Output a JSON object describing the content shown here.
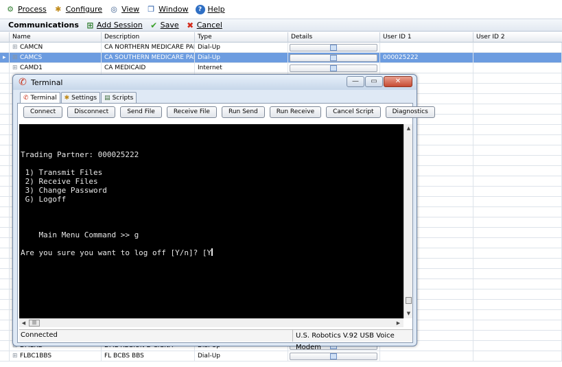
{
  "menubar": {
    "items": [
      {
        "label": "Process",
        "icon": "process-icon"
      },
      {
        "label": "Configure",
        "icon": "configure-icon"
      },
      {
        "label": "View",
        "icon": "view-icon"
      },
      {
        "label": "Window",
        "icon": "window-icon"
      },
      {
        "label": "Help",
        "icon": "help-icon"
      }
    ]
  },
  "toolbar": {
    "title": "Communications",
    "add_session_label": "Add Session",
    "save_label": "Save",
    "cancel_label": "Cancel"
  },
  "grid": {
    "columns": [
      "Name",
      "Description",
      "Type",
      "Details",
      "User ID 1",
      "User ID 2"
    ],
    "rows": [
      {
        "name": "CAMCN",
        "description": "CA NORTHERN MEDICARE PART B",
        "type": "Dial-Up",
        "user_id_1": "",
        "user_id_2": ""
      },
      {
        "name": "CAMCS",
        "description": "CA SOUTHERN MEDICARE PART B",
        "type": "Dial-Up",
        "user_id_1": "000025222",
        "user_id_2": "",
        "selected": true
      },
      {
        "name": "CAMD1",
        "description": "CA MEDICAID",
        "type": "Internet",
        "user_id_1": "",
        "user_id_2": ""
      }
    ],
    "bottom_rows": [
      {
        "name": "DMERD",
        "description": "DME REGION D CIGNA",
        "type": "Dial-Up"
      },
      {
        "name": "FLBC1BBS",
        "description": "FL BCBS BBS",
        "type": "Dial-Up"
      }
    ]
  },
  "terminal": {
    "title": "Terminal",
    "tabs": [
      "Terminal",
      "Settings",
      "Scripts"
    ],
    "buttons": [
      "Connect",
      "Disconnect",
      "Send File",
      "Receive File",
      "Run Send",
      "Run Receive",
      "Cancel Script",
      "Diagnostics"
    ],
    "screen_lines": [
      "Trading Partner: 000025222",
      "",
      " 1) Transmit Files",
      " 2) Receive Files",
      " 3) Change Password",
      " G) Logoff",
      "",
      "",
      "",
      "    Main Menu Command >> g",
      "",
      "Are you sure you want to log off [Y/n]? [Y"
    ],
    "status_left": "Connected",
    "status_right": "U.S. Robotics V.92 USB Voice Modem"
  },
  "colors": {
    "selected_row": "#6c9ce0",
    "terminal_bg": "#000000",
    "close_button": "#c64a32"
  }
}
